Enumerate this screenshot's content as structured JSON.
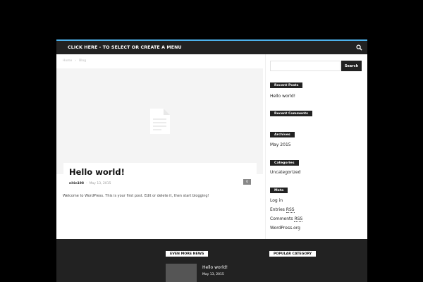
{
  "nav": {
    "menu_label": "CLICK HERE - TO SELECT OR CREATE A MENU",
    "search_icon": "search-icon"
  },
  "breadcrumb": {
    "home": "Home",
    "separator": "›",
    "current": "Blog"
  },
  "post": {
    "image_icon": "document-icon",
    "title": "Hello world!",
    "author": "nitin198",
    "date_separator": "-",
    "date": "May 13, 2015",
    "comments": "0",
    "excerpt": "Welcome to WordPress. This is your first post. Edit or delete it, then start blogging!"
  },
  "sidebar": {
    "search_placeholder": "",
    "search_button": "Search",
    "recent_posts": {
      "title": "Recent Posts",
      "items": [
        "Hello world!"
      ]
    },
    "recent_comments": {
      "title": "Recent Comments"
    },
    "archives": {
      "title": "Archives",
      "items": [
        "May 2015"
      ]
    },
    "categories": {
      "title": "Categories",
      "items": [
        "Uncategorized"
      ]
    },
    "meta": {
      "title": "Meta",
      "items": [
        "Log in",
        "Entries",
        "RSS",
        "Comments",
        "RSS",
        "WordPress.org"
      ]
    }
  },
  "footer": {
    "even_more_title": "EVEN MORE NEWS",
    "popular_title": "POPULAR CATEGORY",
    "post_title": "Hello world!",
    "post_date": "May 13, 2015"
  },
  "colors": {
    "accent": "#4db2ec",
    "dark": "#222222",
    "background": "#000000"
  }
}
